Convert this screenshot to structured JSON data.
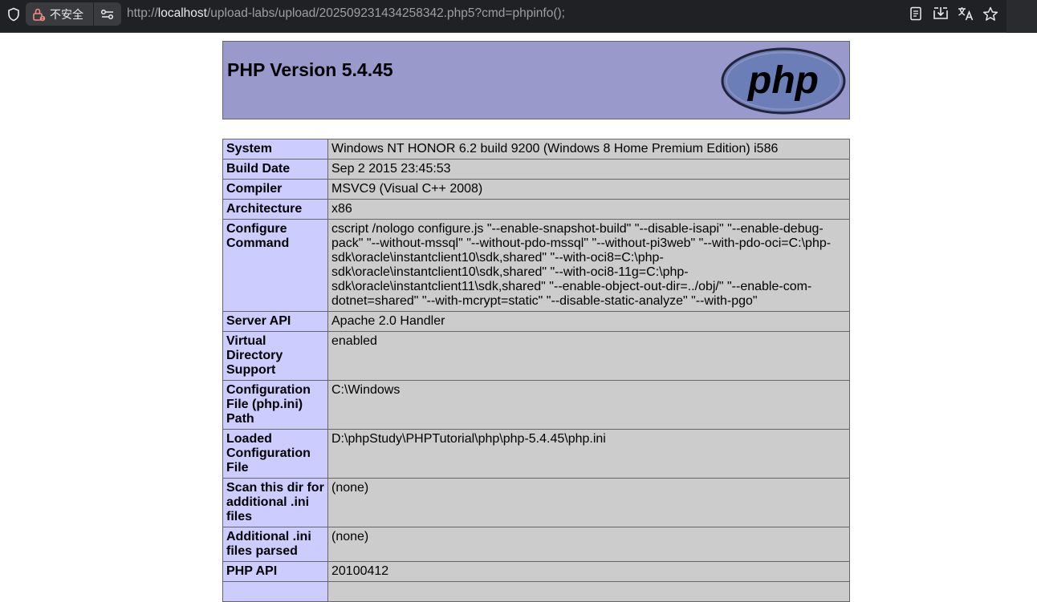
{
  "browser": {
    "security_label": "不安全",
    "url_scheme": "http://",
    "url_host": "localhost",
    "url_path": "/upload-labs/upload/202509231434258342.php5?cmd=phpinfo();",
    "icons": [
      "shield-icon",
      "lock-warning-icon",
      "site-settings-icon",
      "reader-mode-icon",
      "install-app-icon",
      "translate-icon",
      "bookmark-star-icon"
    ]
  },
  "header": {
    "title": "PHP Version 5.4.45",
    "logo_text": "php"
  },
  "info_rows": [
    {
      "key": "System",
      "value": "Windows NT HONOR 6.2 build 9200 (Windows 8 Home Premium Edition) i586"
    },
    {
      "key": "Build Date",
      "value": "Sep 2 2015 23:45:53"
    },
    {
      "key": "Compiler",
      "value": "MSVC9 (Visual C++ 2008)"
    },
    {
      "key": "Architecture",
      "value": "x86"
    },
    {
      "key": "Configure Command",
      "value": "cscript /nologo configure.js \"--enable-snapshot-build\" \"--disable-isapi\" \"--enable-debug-pack\" \"--without-mssql\" \"--without-pdo-mssql\" \"--without-pi3web\" \"--with-pdo-oci=C:\\php-sdk\\oracle\\instantclient10\\sdk,shared\" \"--with-oci8=C:\\php-sdk\\oracle\\instantclient10\\sdk,shared\" \"--with-oci8-11g=C:\\php-sdk\\oracle\\instantclient11\\sdk,shared\" \"--enable-object-out-dir=../obj/\" \"--enable-com-dotnet=shared\" \"--with-mcrypt=static\" \"--disable-static-analyze\" \"--with-pgo\""
    },
    {
      "key": "Server API",
      "value": "Apache 2.0 Handler"
    },
    {
      "key": "Virtual Directory Support",
      "value": "enabled"
    },
    {
      "key": "Configuration File (php.ini) Path",
      "value": "C:\\Windows"
    },
    {
      "key": "Loaded Configuration File",
      "value": "D:\\phpStudy\\PHPTutorial\\php\\php-5.4.45\\php.ini"
    },
    {
      "key": "Scan this dir for additional .ini files",
      "value": "(none)"
    },
    {
      "key": "Additional .ini files parsed",
      "value": "(none)"
    },
    {
      "key": "PHP API",
      "value": "20100412"
    },
    {
      "key": "",
      "value": ""
    }
  ]
}
